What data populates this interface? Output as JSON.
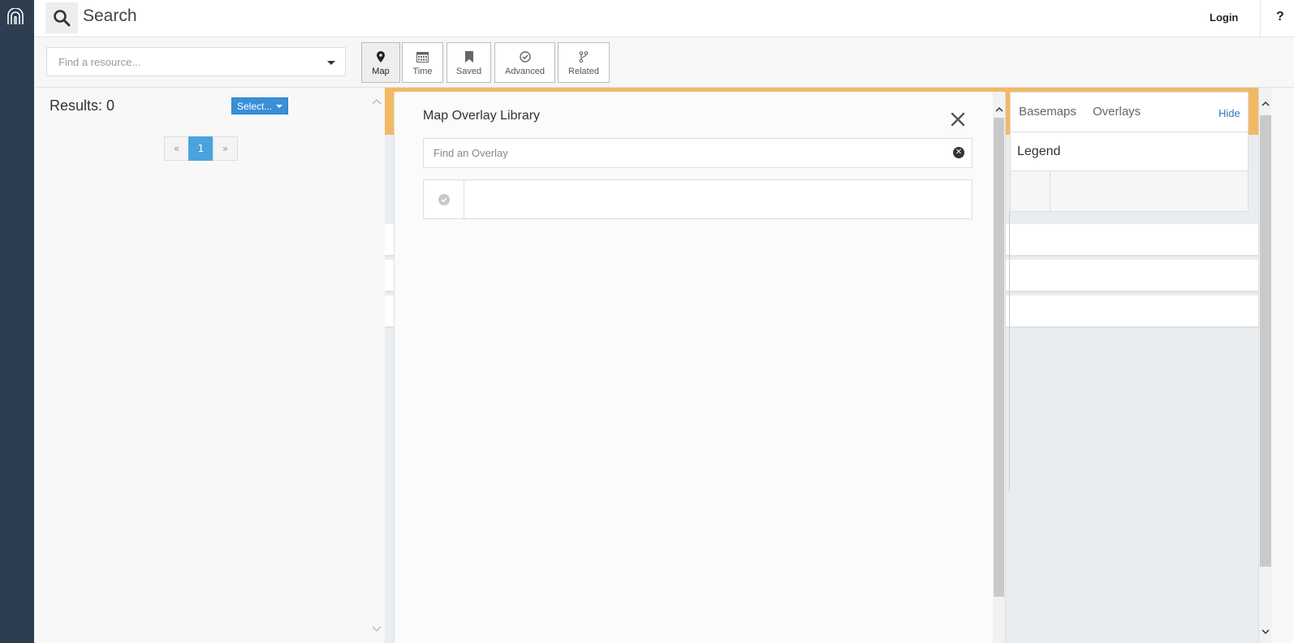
{
  "header": {
    "title": "Search",
    "login_label": "Login",
    "help_label": "?"
  },
  "toolbar": {
    "resource_placeholder": "Find a resource...",
    "buttons": [
      {
        "label": "Map",
        "icon": "map-pin-icon",
        "active": true
      },
      {
        "label": "Time",
        "icon": "calendar-icon",
        "active": false
      },
      {
        "label": "Saved",
        "icon": "bookmark-icon",
        "active": false
      },
      {
        "label": "Advanced",
        "icon": "check-circle-icon",
        "active": false
      },
      {
        "label": "Related",
        "icon": "branch-icon",
        "active": false
      }
    ]
  },
  "results": {
    "title": "Results: 0",
    "select_label": "Select...",
    "pagination": {
      "prev": "«",
      "current": "1",
      "next": "»"
    }
  },
  "overlay_library": {
    "title": "Map Overlay Library",
    "search_placeholder": "Find an Overlay"
  },
  "map_panel": {
    "tabs": [
      "Basemaps",
      "Overlays"
    ],
    "hide_label": "Hide",
    "legend_title": "Legend"
  },
  "colors": {
    "sidebar": "#2c3e50",
    "accent_blue": "#4aa3df",
    "map_header": "#f2b964",
    "link": "#2f7bbf"
  }
}
